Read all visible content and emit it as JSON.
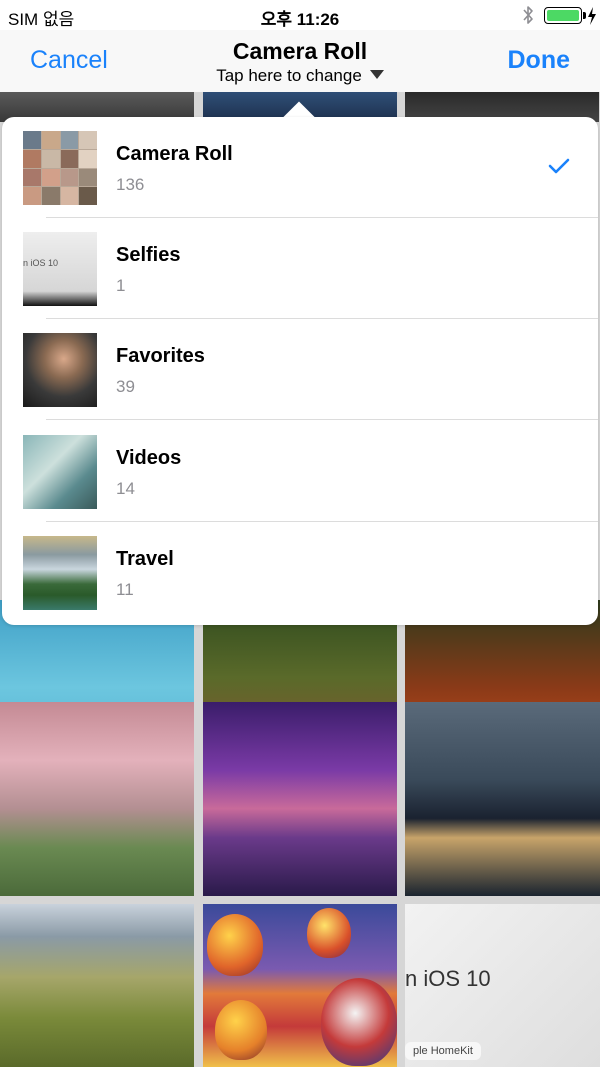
{
  "status_bar": {
    "carrier": "SIM 없음",
    "time": "오후 11:26",
    "bluetooth_icon": "bluetooth-icon",
    "battery_icon": "battery-full-charging-icon",
    "battery_color": "#4cd964"
  },
  "nav": {
    "cancel_label": "Cancel",
    "title": "Camera Roll",
    "subtitle": "Tap here to change",
    "subtitle_icon": "caret-down-icon",
    "done_label": "Done",
    "accent_color": "#1a82fb"
  },
  "albums": [
    {
      "name": "Camera Roll",
      "count": "136",
      "selected": true
    },
    {
      "name": "Selfies",
      "count": "1",
      "selected": false
    },
    {
      "name": "Favorites",
      "count": "39",
      "selected": false
    },
    {
      "name": "Videos",
      "count": "14",
      "selected": false
    },
    {
      "name": "Travel",
      "count": "11",
      "selected": false
    }
  ],
  "selected_icon": "checkmark-icon",
  "thumbnail_texts": {
    "selfies": "n iOS 10"
  },
  "grid": {
    "ios_tile_text": "n iOS 10",
    "ios_tile_subtext": "ple HomeKit"
  }
}
